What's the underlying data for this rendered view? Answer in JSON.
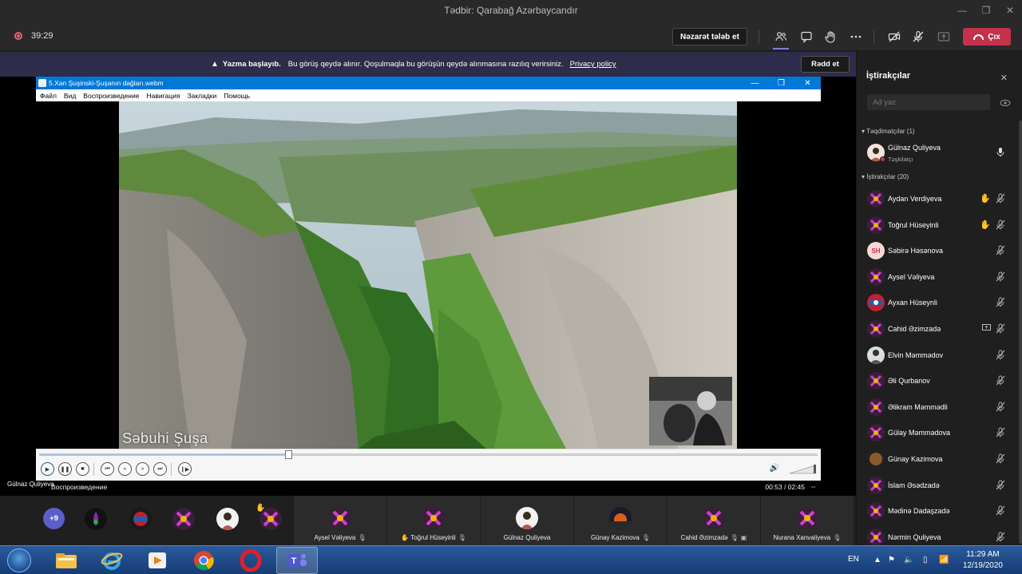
{
  "window": {
    "title": "Tədbir: Qarabağ Azərbaycandır"
  },
  "toolbar": {
    "timer": "39:29",
    "take_control_label": "Nəzarət tələb et",
    "leave_label": "Çıx",
    "icons": [
      "participants-icon",
      "chat-icon",
      "raise-hand-icon",
      "more-icon",
      "camera-off-icon",
      "mic-off-icon",
      "share-tray-icon"
    ]
  },
  "banner": {
    "bold": "Yazma başlayıb.",
    "text": "Bu görüş qeydə alınır. Qoşulmaqla bu görüşün qeydə alınmasına razılıq verirsiniz.",
    "link": "Privacy policy",
    "dismiss_label": "Rədd et"
  },
  "player": {
    "file_title": "5.Xan Şuşinski-Şuşanın dağları.webm",
    "menu": [
      "Файл",
      "Вид",
      "Воспроизведение",
      "Навигация",
      "Закладки",
      "Помощь"
    ],
    "overlay_text": "Səbuhi Şuşa",
    "status_left": "Воспроизведение",
    "time": "00:53 / 02:45",
    "progress": 0.32
  },
  "presenter_label": "Gülnaz Quliyeva",
  "strip": {
    "overflow": "+9",
    "tiles": [
      {
        "name": "Aysel Vəliyeva",
        "hand": false
      },
      {
        "name": "Toğrul Hüseyinli",
        "hand": true
      },
      {
        "name": "Gülnaz Quliyeva",
        "hand": false
      },
      {
        "name": "Günay Kazimova",
        "hand": false
      },
      {
        "name": "Cahid Əzimzadə",
        "hand": false
      },
      {
        "name": "Nurana Xanvaliyeva",
        "hand": false
      }
    ]
  },
  "panel": {
    "title": "İştirakçılar",
    "search_placeholder": "Ad yaz",
    "presenters_header": "Təqdimatçılar (1)",
    "attendees_header": "İştirakçılar (20)",
    "presenter": {
      "name": "Gülnaz Quliyeva",
      "role": "Təşkilatçı"
    },
    "attendees": [
      {
        "name": "Aydan Verdiyeva",
        "hand": true
      },
      {
        "name": "Toğrul Hüseyinli",
        "hand": true
      },
      {
        "name": "Səbirə Həsənova",
        "initials": "SH"
      },
      {
        "name": "Aysel Vəliyeva"
      },
      {
        "name": "Ayxan Hüseynli"
      },
      {
        "name": "Cahid Əzimzadə",
        "sharing": true
      },
      {
        "name": "Elvin Məmmədov"
      },
      {
        "name": "Əli Qurbanov"
      },
      {
        "name": "Əlikram Məmmədli"
      },
      {
        "name": "Gülay Məmmədova"
      },
      {
        "name": "Günay Kazimova"
      },
      {
        "name": "İslam Əsədzadə"
      },
      {
        "name": "Mədinə Dadaşzadə"
      },
      {
        "name": "Nərmin Quliyeva"
      }
    ]
  },
  "taskbar": {
    "lang": "EN",
    "time": "11:29 AM",
    "date": "12/19/2020"
  },
  "colors": {
    "accent": "#5b5fc7",
    "leave": "#c4314b",
    "banner": "#2d2c4a",
    "player_title": "#0078d7"
  }
}
